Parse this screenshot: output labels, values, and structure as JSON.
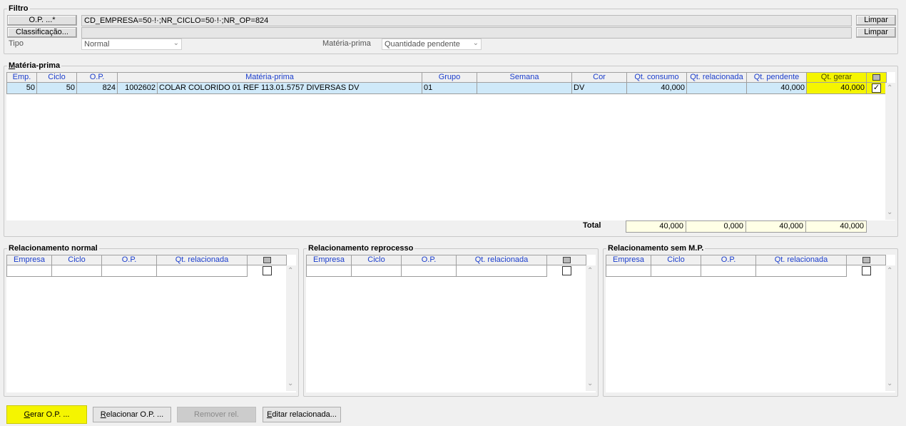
{
  "filtro": {
    "title": "Filtro",
    "op_button": "O.P. ...*",
    "op_value": "CD_EMPRESA=50·!·;NR_CICLO=50·!·;NR_OP=824",
    "classificacao_button": "Classificação...",
    "classificacao_value": "",
    "limpar_label": "Limpar",
    "tipo_label": "Tipo",
    "tipo_value": "Normal",
    "materia_prima_label": "Matéria-prima",
    "materia_prima_value": "Quantidade pendente"
  },
  "materia_prima": {
    "title_first": "M",
    "title_rest": "atéria-prima",
    "columns": [
      "Emp.",
      "Ciclo",
      "O.P.",
      "Matéria-prima",
      "Grupo",
      "Semana",
      "Cor",
      "Qt. consumo",
      "Qt. relacionada",
      "Qt. pendente",
      "Qt. gerar"
    ],
    "rows": [
      {
        "emp": "50",
        "ciclo": "50",
        "op": "824",
        "codigo": "1002602",
        "materia_prima": "COLAR COLORIDO 01 REF 113.01.5757 DIVERSAS DV",
        "grupo": "01",
        "semana": "",
        "cor": "DV",
        "qt_consumo": "40,000",
        "qt_relacionada": "",
        "qt_pendente": "40,000",
        "qt_gerar": "40,000",
        "checked": "✓"
      }
    ],
    "total_label": "Total",
    "totals": {
      "qt_consumo": "40,000",
      "qt_relacionada": "0,000",
      "qt_pendente": "40,000",
      "qt_gerar": "40,000"
    }
  },
  "relacionamentos": [
    {
      "title": "Relacionamento normal",
      "columns": [
        "Empresa",
        "Ciclo",
        "O.P.",
        "Qt. relacionada"
      ]
    },
    {
      "title": "Relacionamento reprocesso",
      "columns": [
        "Empresa",
        "Ciclo",
        "O.P.",
        "Qt. relacionada"
      ]
    },
    {
      "title": "Relacionamento sem M.P.",
      "columns": [
        "Empresa",
        "Ciclo",
        "O.P.",
        "Qt. relacionada"
      ]
    }
  ],
  "actions": {
    "gerar_first": "G",
    "gerar_rest": "erar O.P. ...",
    "relacionar_first": "R",
    "relacionar_rest": "elacionar O.P. ...",
    "remover": "Remover rel.",
    "editar_first": "E",
    "editar_rest": "ditar relacionada..."
  },
  "colors": {
    "highlight": "#f5f500",
    "selected_row": "#cfe9f9",
    "header_text": "#1a3dcc"
  }
}
